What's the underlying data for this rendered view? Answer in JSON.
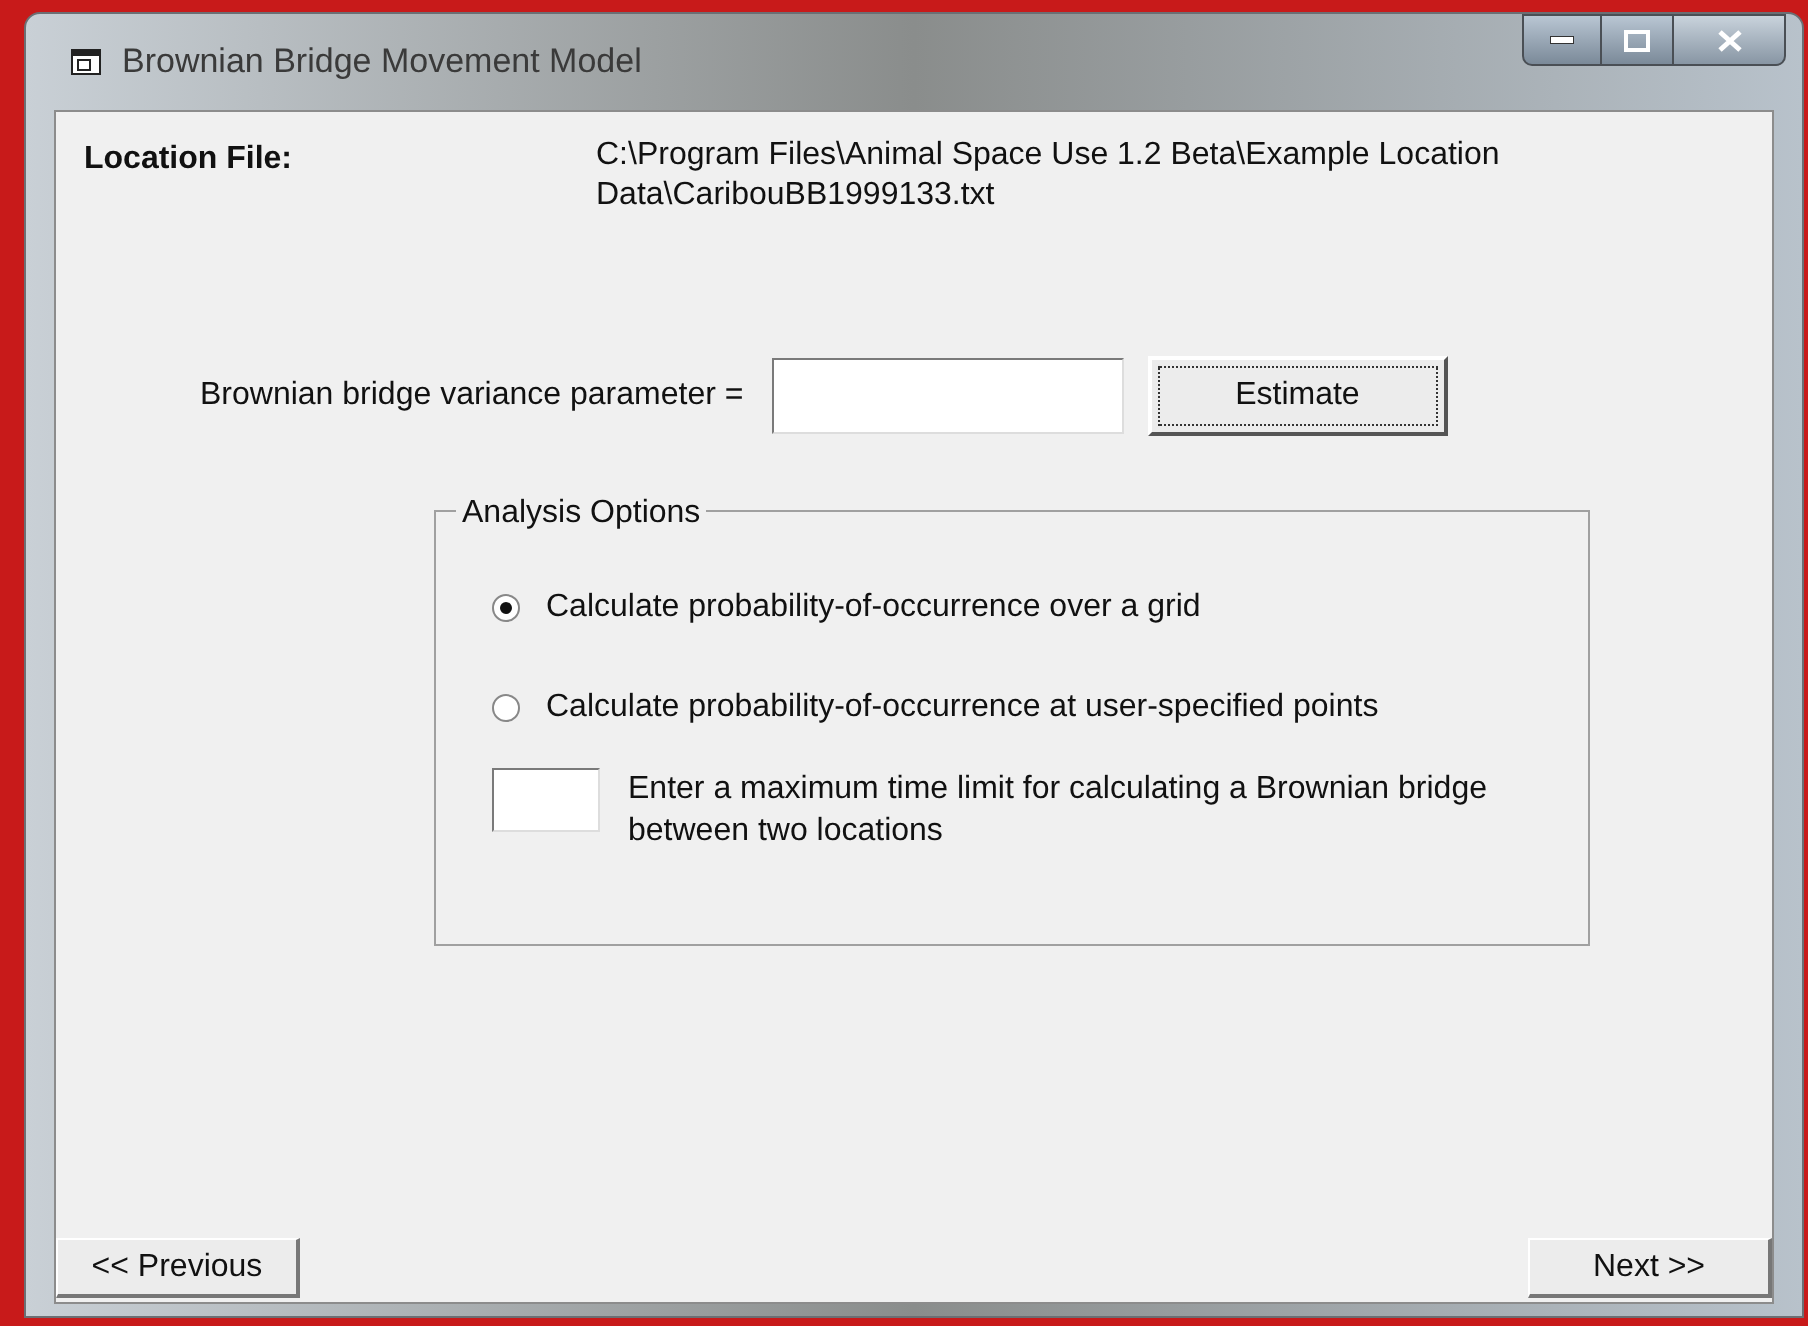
{
  "window": {
    "title": "Brownian Bridge Movement Model"
  },
  "location_file": {
    "label": "Location File:",
    "path": "C:\\Program Files\\Animal Space Use 1.2 Beta\\Example Location Data\\CaribouBB1999133.txt"
  },
  "variance": {
    "label": "Brownian bridge variance parameter =",
    "button": "Estimate"
  },
  "analysis_options": {
    "title": "Analysis Options",
    "options": [
      {
        "label": "Calculate probability-of-occurrence over a grid",
        "selected": true
      },
      {
        "label": "Calculate probability-of-occurrence at user-specified points",
        "selected": false
      }
    ],
    "time_limit_label": "Enter a maximum time limit for calculating a Brownian bridge between two locations"
  },
  "buttons": {
    "previous": "<< Previous",
    "next": "Next >>"
  }
}
